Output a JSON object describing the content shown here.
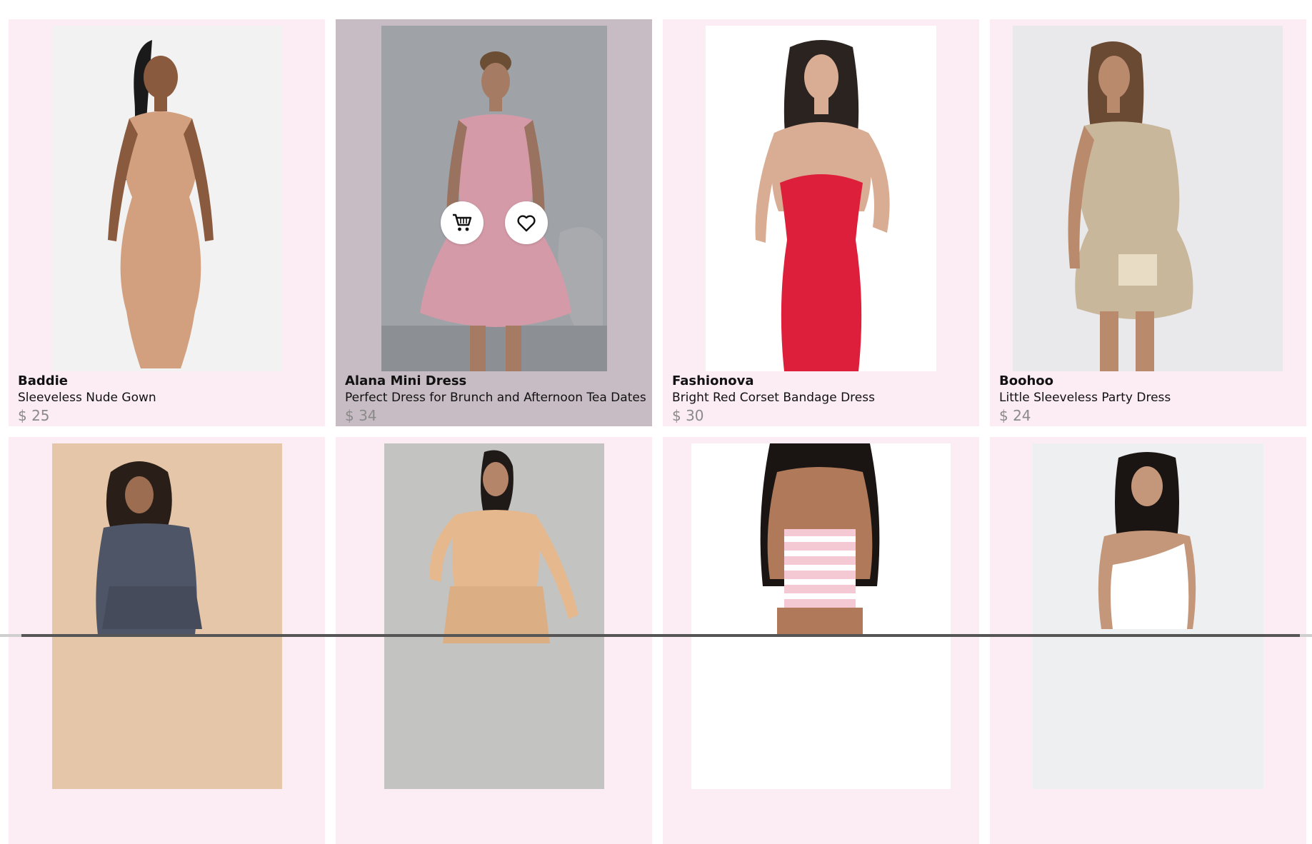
{
  "colors": {
    "card_background": "#fcecf3",
    "card_hover_background": "#c8bcc4",
    "price_text": "#8a8a8a"
  },
  "products": [
    {
      "brand": "Baddie",
      "description": "Sleeveless Nude Gown",
      "price": "$ 25",
      "dress_color": "#d3a07f",
      "photo_bg": "#f2f2f2"
    },
    {
      "brand": "Alana Mini Dress",
      "description": "Perfect Dress for Brunch and Afternoon Tea Dates",
      "price": "$ 34",
      "dress_color": "#f2b7c7",
      "photo_bg": "#c9cbcf"
    },
    {
      "brand": "Fashionova",
      "description": "Bright Red Corset Bandage Dress",
      "price": "$ 30",
      "dress_color": "#de1f3c",
      "photo_bg": "#ffffff"
    },
    {
      "brand": "Boohoo",
      "description": "Little Sleeveless Party Dress",
      "price": "$ 24",
      "dress_color": "#c9b79b",
      "photo_bg": "#e9e9eb"
    },
    {
      "dress_color": "#4e5566",
      "photo_bg": "#e5c6a8"
    },
    {
      "dress_color": "#e6b88d",
      "photo_bg": "#c3c3c1"
    },
    {
      "dress_color": "#f4c9d4",
      "photo_bg": "#ffffff"
    },
    {
      "dress_color": "#ffffff",
      "photo_bg": "#eeeff1"
    }
  ],
  "hover_actions": {
    "cart_icon": "cart-icon",
    "wishlist_icon": "heart-icon"
  }
}
